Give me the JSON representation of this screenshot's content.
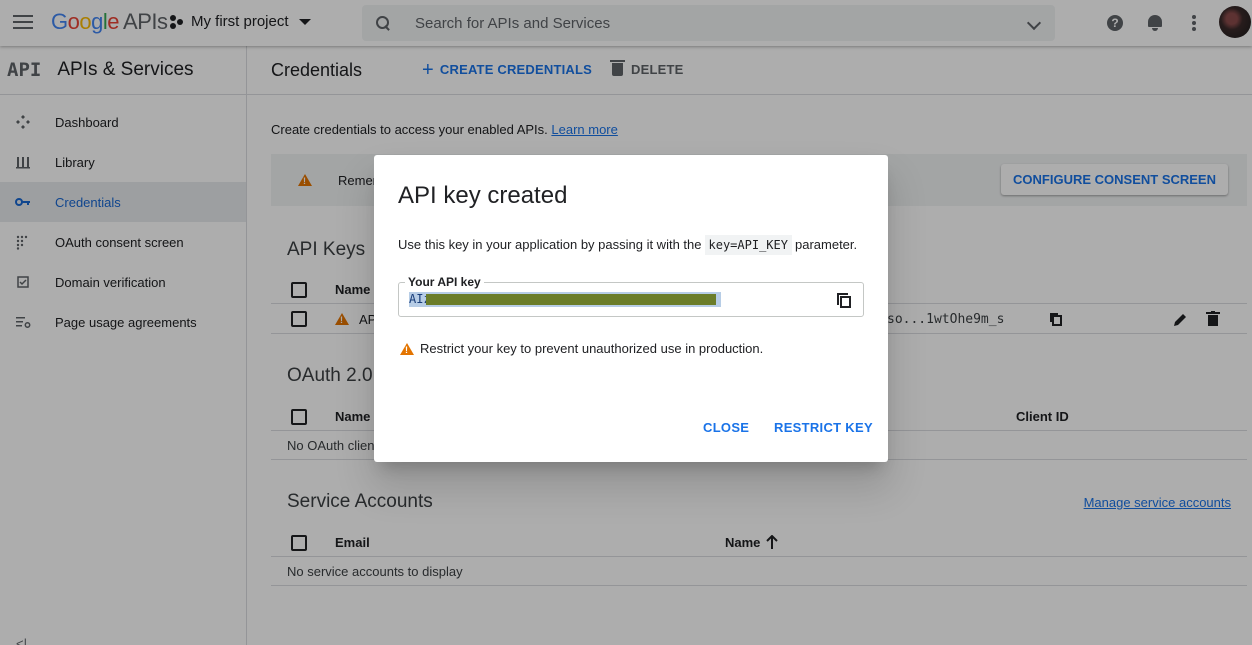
{
  "header": {
    "logo_google": [
      "G",
      "o",
      "o",
      "g",
      "l",
      "e"
    ],
    "logo_apis": "APIs",
    "project_name": "My first project",
    "search_placeholder": "Search for APIs and Services"
  },
  "sidebar": {
    "logo": "API",
    "title": "APIs & Services",
    "items": [
      {
        "label": "Dashboard",
        "icon": "dashboard-icon"
      },
      {
        "label": "Library",
        "icon": "library-icon"
      },
      {
        "label": "Credentials",
        "icon": "key-icon",
        "active": true
      },
      {
        "label": "OAuth consent screen",
        "icon": "oauth-icon"
      },
      {
        "label": "Domain verification",
        "icon": "domain-check-icon"
      },
      {
        "label": "Page usage agreements",
        "icon": "settings-list-icon"
      }
    ],
    "collapse": "<|"
  },
  "main": {
    "title": "Credentials",
    "create_label": "CREATE CREDENTIALS",
    "delete_label": "DELETE",
    "intro_text": "Create credentials to access your enabled APIs.",
    "learn_more": "Learn more",
    "banner_text": "Remem",
    "consent_button": "CONFIGURE CONSENT SCREEN",
    "api_keys": {
      "title": "API Keys",
      "col_name": "Name",
      "row_name": "AP",
      "row_key": "so...1wtOhe9m_s"
    },
    "oauth": {
      "title": "OAuth 2.0",
      "col_name": "Name",
      "col_client_id": "Client ID",
      "empty": "No OAuth client"
    },
    "service_accounts": {
      "title": "Service Accounts",
      "manage_link": "Manage service accounts",
      "col_email": "Email",
      "col_name": "Name",
      "empty": "No service accounts to display"
    }
  },
  "dialog": {
    "title": "API key created",
    "desc_before": "Use this key in your application by passing it with the",
    "desc_code": "key=API_KEY",
    "desc_after": "parameter.",
    "field_label": "Your API key",
    "key_prefix": "AIz",
    "warning": "Restrict your key to prevent unauthorized use in production.",
    "close_label": "CLOSE",
    "restrict_label": "RESTRICT KEY"
  },
  "colors": {
    "accent": "#1a73e8",
    "warning": "#e37400",
    "active_bg": "#e8eaed"
  }
}
